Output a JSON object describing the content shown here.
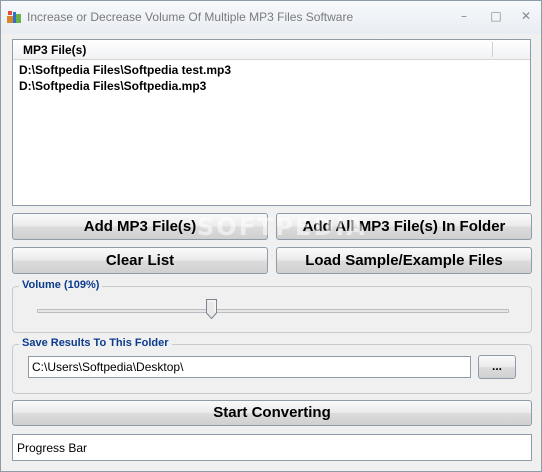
{
  "window": {
    "title": "Increase or Decrease Volume Of Multiple MP3 Files Software",
    "icon": "app-icon",
    "minimize_glyph": "–",
    "maximize_glyph": "□",
    "close_glyph": "✕"
  },
  "file_list": {
    "column_header": "MP3 File(s)",
    "files": [
      "D:\\Softpedia Files\\Softpedia test.mp3",
      "D:\\Softpedia Files\\Softpedia.mp3"
    ]
  },
  "buttons": {
    "add_files": "Add MP3 File(s)",
    "add_folder": "Add All MP3 File(s) In Folder",
    "clear_list": "Clear List",
    "load_samples": "Load Sample/Example Files",
    "start_converting": "Start Converting",
    "browse": "..."
  },
  "volume": {
    "label": "Volume (109%)",
    "level_fraction": 0.37
  },
  "output_folder": {
    "label": "Save Results To This Folder",
    "value": "C:\\Users\\Softpedia\\Desktop\\"
  },
  "progress": {
    "label": "Progress Bar",
    "fraction": 0
  },
  "watermark": "SOFTPEDIA",
  "colors": {
    "group_label": "#0b3b8c",
    "window_bg": "#f0f0f0"
  }
}
